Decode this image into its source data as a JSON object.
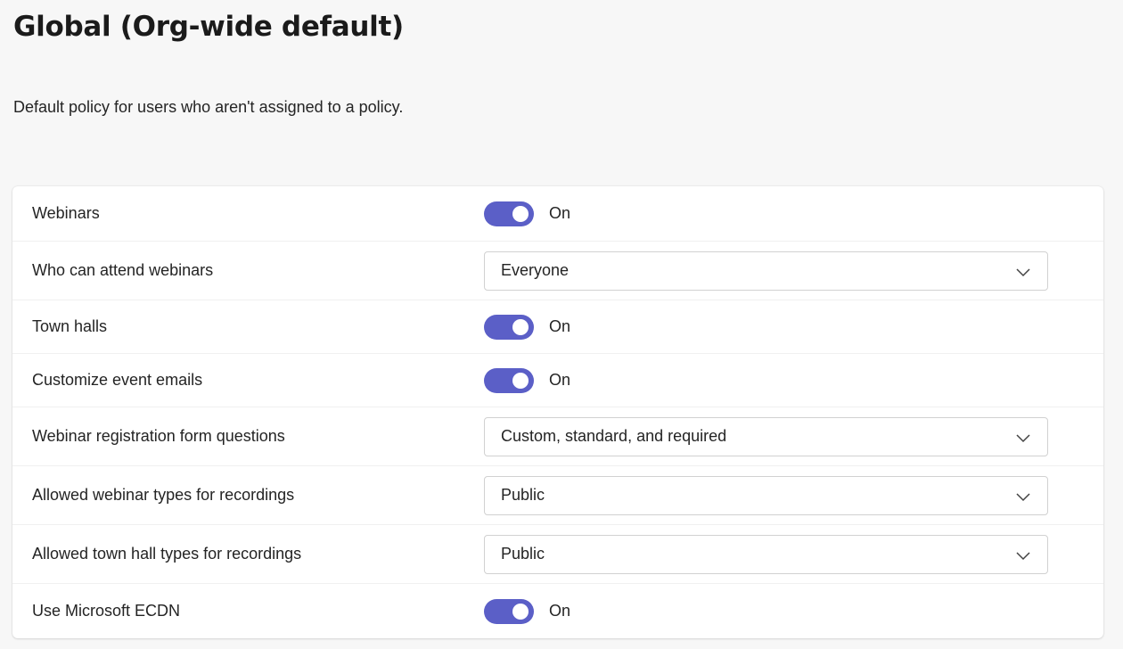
{
  "header": {
    "title": "Global (Org-wide default)",
    "description": "Default policy for users who aren't assigned to a policy."
  },
  "settings": [
    {
      "key": "webinars",
      "label": "Webinars",
      "type": "toggle",
      "value": "On"
    },
    {
      "key": "who-can-attend",
      "label": "Who can attend webinars",
      "type": "select",
      "value": "Everyone"
    },
    {
      "key": "town-halls",
      "label": "Town halls",
      "type": "toggle",
      "value": "On"
    },
    {
      "key": "customize-emails",
      "label": "Customize event emails",
      "type": "toggle",
      "value": "On"
    },
    {
      "key": "registration-questions",
      "label": "Webinar registration form questions",
      "type": "select",
      "value": "Custom, standard, and required"
    },
    {
      "key": "webinar-recording-types",
      "label": "Allowed webinar types for recordings",
      "type": "select",
      "value": "Public"
    },
    {
      "key": "townhall-recording-types",
      "label": "Allowed town hall types for recordings",
      "type": "select",
      "value": "Public"
    },
    {
      "key": "ecdn",
      "label": "Use Microsoft ECDN",
      "type": "toggle",
      "value": "On"
    }
  ],
  "colors": {
    "toggle_on": "#5b5fc7"
  },
  "icons": {
    "dropdown": "chevron-down-icon"
  }
}
